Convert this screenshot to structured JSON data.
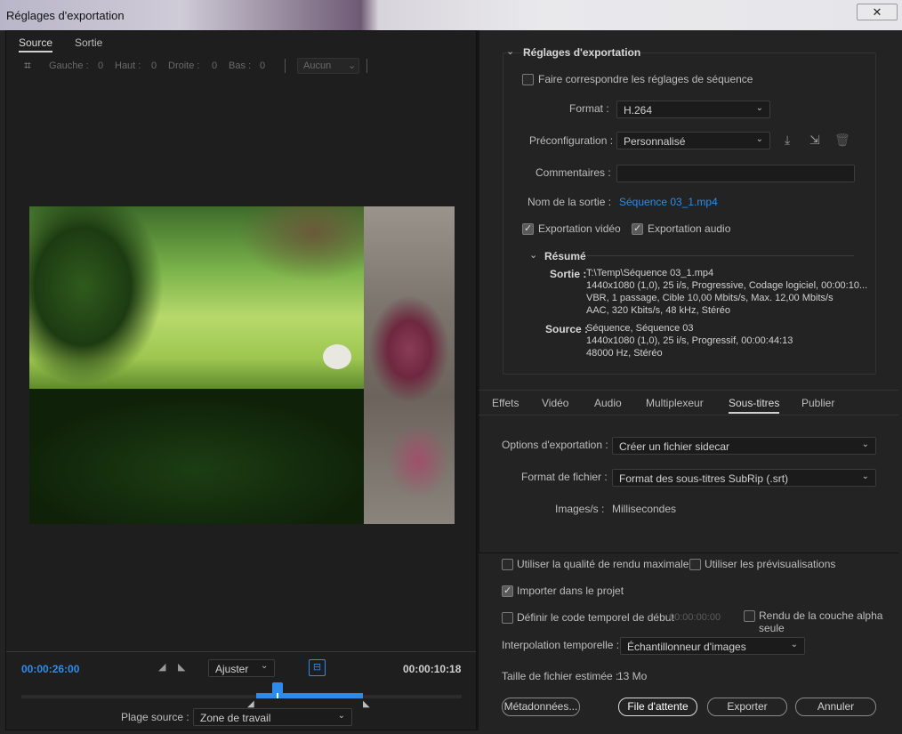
{
  "window": {
    "title": "Réglages d'exportation",
    "close": "✕"
  },
  "left": {
    "tabs": [
      "Source",
      "Sortie"
    ],
    "crop": {
      "gauche_label": "Gauche :",
      "gauche_value": "0",
      "haut_label": "Haut :",
      "haut_value": "0",
      "droite_label": "Droite :",
      "droite_value": "0",
      "bas_label": "Bas :",
      "bas_value": "0",
      "ratio": "Aucun"
    },
    "timeline": {
      "current_time": "00:00:26:00",
      "duration": "00:00:10:18",
      "fit": "Ajuster",
      "source_range_label": "Plage source :",
      "source_range_value": "Zone de travail"
    }
  },
  "export": {
    "section_title": "Réglages d'exportation",
    "match_sequence": "Faire correspondre les réglages de séquence",
    "format_label": "Format :",
    "format_value": "H.264",
    "preset_label": "Préconfiguration :",
    "preset_value": "Personnalisé",
    "comments_label": "Commentaires :",
    "output_name_label": "Nom de la sortie :",
    "output_name_value": "Séquence 03_1.mp4",
    "export_video": "Exportation vidéo",
    "export_audio": "Exportation audio",
    "summary_title": "Résumé",
    "output_label": "Sortie :",
    "output_lines": [
      "T:\\Temp\\Séquence 03_1.mp4",
      "1440x1080 (1,0), 25 i/s, Progressive, Codage logiciel, 00:00:10...",
      "VBR, 1 passage, Cible 10,00  Mbits/s, Max. 12,00  Mbits/s",
      "AAC, 320  Kbits/s, 48  kHz, Stéréo"
    ],
    "source_label": "Source :",
    "source_lines": [
      "Séquence, Séquence 03",
      "1440x1080 (1,0), 25  i/s, Progressif, 00:00:44:13",
      "48000 Hz, Stéréo"
    ]
  },
  "subtabs": [
    "Effets",
    "Vidéo",
    "Audio",
    "Multiplexeur",
    "Sous-titres",
    "Publier"
  ],
  "subtitles": {
    "export_options_label": "Options d'exportation :",
    "export_options_value": "Créer un fichier sidecar",
    "file_format_label": "Format de fichier :",
    "file_format_value": "Format des sous-titres SubRip (.srt)",
    "fps_label": "Images/s :",
    "fps_value": "Millisecondes"
  },
  "bottom": {
    "max_quality": "Utiliser la qualité de rendu maximale",
    "use_previews": "Utiliser les prévisualisations",
    "import_project": "Importer dans le projet",
    "set_timecode": "Définir le code temporel de début",
    "timecode_value": "00:00:00:00",
    "alpha_only": "Rendu de la couche alpha seule",
    "interp_label": "Interpolation temporelle :",
    "interp_value": "Échantillonneur d'images",
    "filesize_label": "Taille de fichier estimée :",
    "filesize_value": "13 Mo",
    "metadata_btn": "Métadonnées...",
    "queue_btn": "File d'attente",
    "export_btn": "Exporter",
    "cancel_btn": "Annuler"
  }
}
